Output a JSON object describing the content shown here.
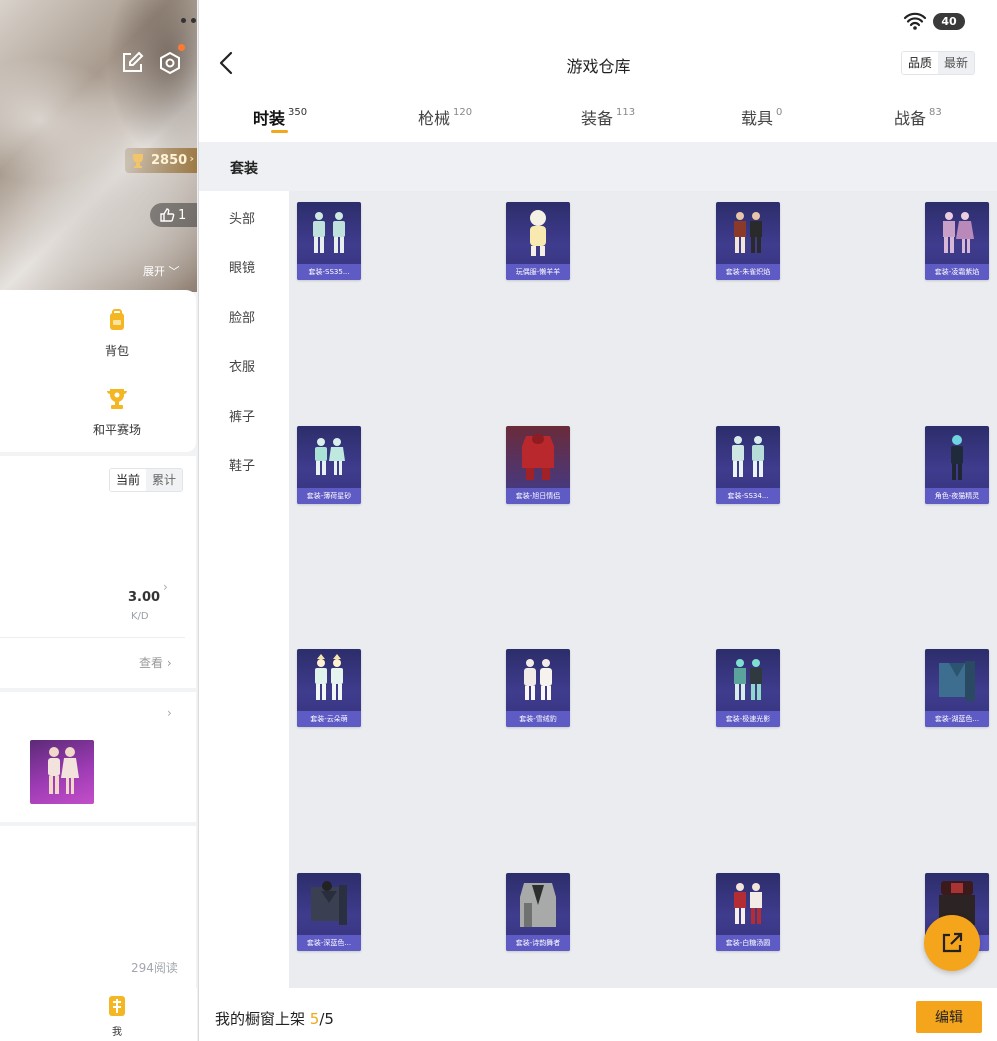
{
  "left_panel": {
    "score": "2850",
    "likes": "1",
    "expand_label": "展开",
    "shortcuts": [
      {
        "label": "背包",
        "icon": "backpack-icon"
      },
      {
        "label": "和平赛场",
        "icon": "trophy-icon"
      }
    ],
    "stats_toggle": {
      "current": "当前",
      "cumulative": "累计"
    },
    "kd_value": "3.00",
    "kd_label": "K/D",
    "view_more": "查看",
    "reads": "294阅读",
    "me_tab_label": "我"
  },
  "status_bar": {
    "battery": "40",
    "wifi_icon": "wifi-icon"
  },
  "header": {
    "title": "游戏仓库",
    "sort_options": [
      "品质",
      "最新"
    ],
    "sort_selected": "品质"
  },
  "tabs": [
    {
      "label": "时装",
      "count": "350",
      "active": true
    },
    {
      "label": "枪械",
      "count": "120"
    },
    {
      "label": "装备",
      "count": "113"
    },
    {
      "label": "载具",
      "count": "0"
    },
    {
      "label": "战备",
      "count": "83"
    }
  ],
  "sidebar": {
    "header": "套装",
    "items": [
      "头部",
      "眼镜",
      "脸部",
      "衣服",
      "裤子",
      "鞋子"
    ]
  },
  "items": [
    {
      "name": "套装-SS35..."
    },
    {
      "name": "玩偶服-懒羊羊"
    },
    {
      "name": "套装-朱雀炽焰"
    },
    {
      "name": "套装-凌霜紫焰"
    },
    {
      "name": "套装-薄荷星砂"
    },
    {
      "name": "套装-旭日情侣"
    },
    {
      "name": "套装-SS34..."
    },
    {
      "name": "角色-夜猫精灵"
    },
    {
      "name": "套装-云朵萌"
    },
    {
      "name": "套装-雪绒豹"
    },
    {
      "name": "套装-极速光影"
    },
    {
      "name": "套装-湖蓝色..."
    },
    {
      "name": "套装-深蓝色..."
    },
    {
      "name": "套装-诗韵舞者"
    },
    {
      "name": "套装-白糖汤圆"
    },
    {
      "name": "套装-..."
    }
  ],
  "footer": {
    "prefix": "我的橱窗上架 ",
    "shown": "5",
    "total": "/5",
    "edit_label": "编辑"
  },
  "colors": {
    "accent": "#f5a51c",
    "item_bg": "#3f3c8e",
    "item_caption": "#5f5bc4"
  }
}
